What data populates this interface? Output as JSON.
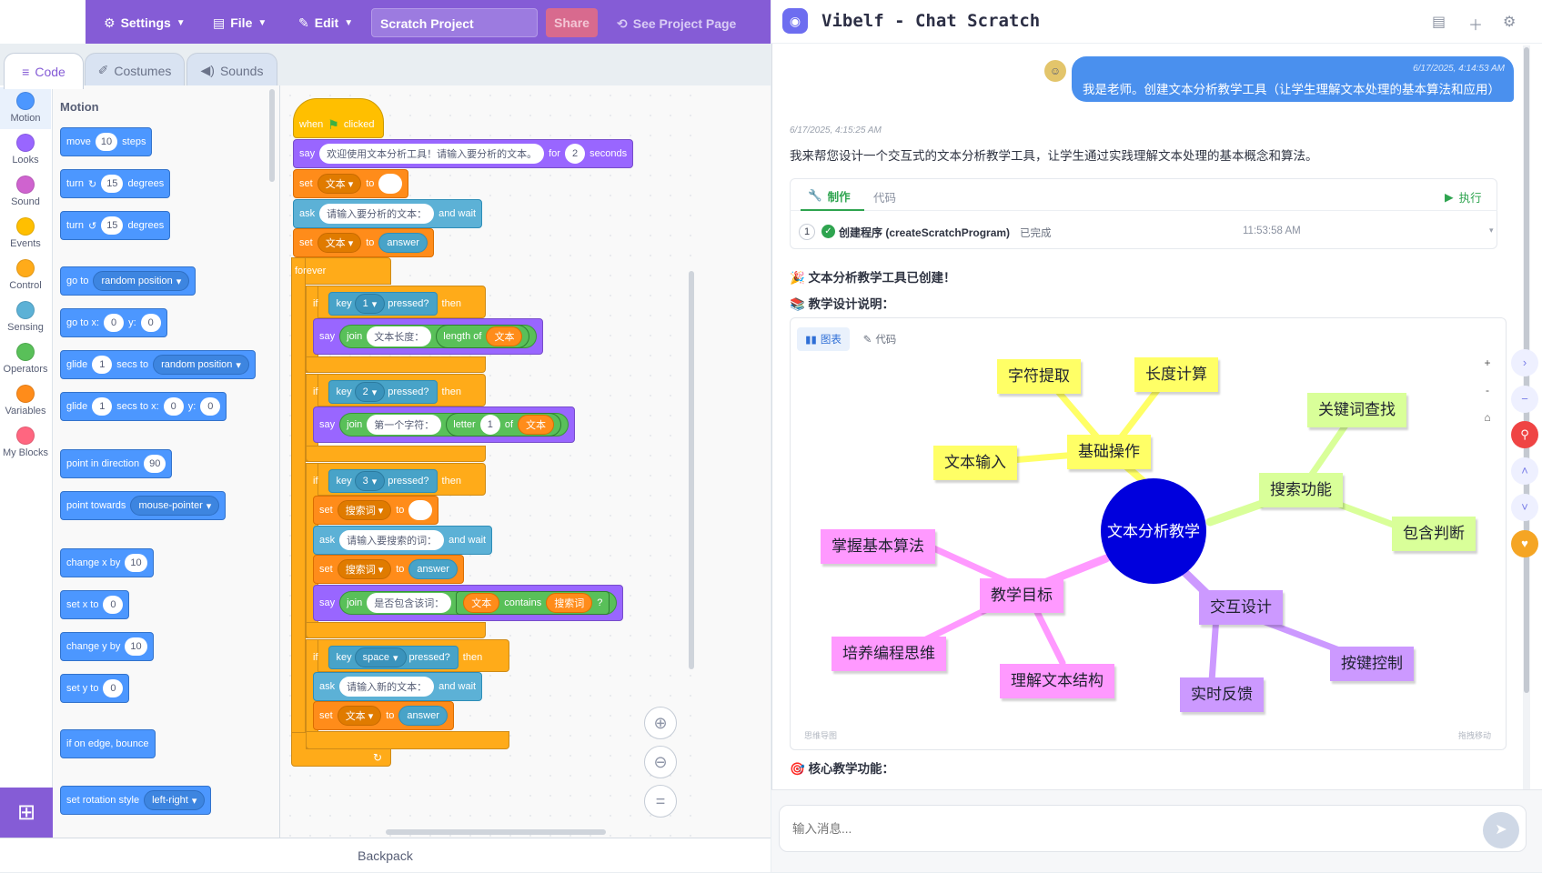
{
  "menubar": {
    "settings": "Settings",
    "file": "File",
    "edit": "Edit",
    "project_name": "Scratch Project",
    "share": "Share",
    "see_project": "See Project Page"
  },
  "tabs": {
    "code": "Code",
    "costumes": "Costumes",
    "sounds": "Sounds"
  },
  "categories": [
    {
      "label": "Motion",
      "color": "#4c97ff"
    },
    {
      "label": "Looks",
      "color": "#9966ff"
    },
    {
      "label": "Sound",
      "color": "#cf63cf"
    },
    {
      "label": "Events",
      "color": "#ffbf00"
    },
    {
      "label": "Control",
      "color": "#ffab19"
    },
    {
      "label": "Sensing",
      "color": "#5cb1d6"
    },
    {
      "label": "Operators",
      "color": "#59c059"
    },
    {
      "label": "Variables",
      "color": "#ff8c1a"
    },
    {
      "label": "My Blocks",
      "color": "#ff6680"
    }
  ],
  "palette": {
    "header": "Motion",
    "move": {
      "a": "move",
      "v": "10",
      "b": "steps"
    },
    "turn_r": {
      "a": "turn",
      "v": "15",
      "b": "degrees"
    },
    "turn_l": {
      "a": "turn",
      "v": "15",
      "b": "degrees"
    },
    "goto": {
      "a": "go to",
      "d": "random position"
    },
    "gotoxy": {
      "a": "go to x:",
      "x": "0",
      "y_l": "y:",
      "y": "0"
    },
    "glide": {
      "a": "glide",
      "v": "1",
      "b": "secs to",
      "d": "random position"
    },
    "glidexy": {
      "a": "glide",
      "v": "1",
      "b": "secs to x:",
      "x": "0",
      "y_l": "y:",
      "y": "0"
    },
    "point_dir": {
      "a": "point in direction",
      "v": "90"
    },
    "point_towards": {
      "a": "point towards",
      "d": "mouse-pointer"
    },
    "changex": {
      "a": "change x by",
      "v": "10"
    },
    "setx": {
      "a": "set x to",
      "v": "0"
    },
    "changey": {
      "a": "change y by",
      "v": "10"
    },
    "sety": {
      "a": "set y to",
      "v": "0"
    },
    "bounce": "if on edge, bounce",
    "rotation": {
      "a": "set rotation style",
      "d": "left-right"
    }
  },
  "script": {
    "when": "when",
    "clicked": "clicked",
    "say1": {
      "a": "say",
      "t": "欢迎使用文本分析工具！请输入要分析的文本。",
      "for": "for",
      "n": "2",
      "sec": "seconds"
    },
    "set1": {
      "a": "set",
      "var": "文本",
      "to": "to",
      "val": ""
    },
    "ask1": {
      "a": "ask",
      "t": "请输入要分析的文本：",
      "w": "and wait"
    },
    "set2": {
      "a": "set",
      "var": "文本",
      "to": "to",
      "ans": "answer"
    },
    "forever": "forever",
    "if1": {
      "if": "if",
      "key": "key",
      "k": "1",
      "pressed": "pressed?",
      "then": "then"
    },
    "say2": {
      "a": "say",
      "join": "join",
      "t": "文本长度：",
      "len": "length of",
      "var": "文本"
    },
    "if2": {
      "if": "if",
      "key": "key",
      "k": "2",
      "pressed": "pressed?",
      "then": "then"
    },
    "say3": {
      "a": "say",
      "join": "join",
      "t": "第一个字符：",
      "letter": "letter",
      "n": "1",
      "of": "of",
      "var": "文本"
    },
    "if3": {
      "if": "if",
      "key": "key",
      "k": "3",
      "pressed": "pressed?",
      "then": "then"
    },
    "set3": {
      "a": "set",
      "var": "搜索词",
      "to": "to",
      "val": ""
    },
    "ask2": {
      "a": "ask",
      "t": "请输入要搜索的词：",
      "w": "and wait"
    },
    "set4": {
      "a": "set",
      "var": "搜索词",
      "to": "to",
      "ans": "answer"
    },
    "say4": {
      "a": "say",
      "join": "join",
      "t": "是否包含该词：",
      "var": "文本",
      "contains": "contains",
      "var2": "搜索词",
      "q": "?"
    },
    "if4": {
      "if": "if",
      "key": "key",
      "k": "space",
      "pressed": "pressed?",
      "then": "then"
    },
    "ask3": {
      "a": "ask",
      "t": "请输入新的文本：",
      "w": "and wait"
    },
    "set5": {
      "a": "set",
      "var": "文本",
      "to": "to",
      "ans": "answer"
    }
  },
  "backpack": "Backpack",
  "chat": {
    "title": "Vibelf - Chat Scratch",
    "user_ts": "6/17/2025, 4:14:53 AM",
    "user_msg": "我是老师。创建文本分析教学工具（让学生理解文本处理的基本算法和应用）",
    "bot_ts": "6/17/2025, 4:15:25 AM",
    "bot_msg": "我来帮您设计一个交互式的文本分析教学工具，让学生通过实践理解文本处理的基本概念和算法。",
    "tool_tab_make": "制作",
    "tool_tab_code": "代码",
    "run": "执行",
    "step_num": "1",
    "step_label": "创建程序 (createScratchProgram)",
    "step_status": "已完成",
    "step_time": "11:53:58 AM",
    "msg_created": "🎉 文本分析教学工具已创建！",
    "msg_design": "📚 教学设计说明：",
    "map_tab_chart": "图表",
    "map_tab_code": "代码",
    "map_zoom_in": "+",
    "map_zoom_out": "-",
    "map_home": "⌂",
    "map_label_left": "思维导图",
    "map_label_right": "拖拽移动",
    "msg_core": "🎯 核心教学功能：",
    "input_placeholder": "输入消息..."
  },
  "mindmap": {
    "center": "文本分析教学",
    "nodes": {
      "basic": "基础操作",
      "extract": "字符提取",
      "length": "长度计算",
      "input": "文本输入",
      "search": "搜索功能",
      "keyword": "关键词查找",
      "contains": "包含判断",
      "goal": "教学目标",
      "algo": "掌握基本算法",
      "thinking": "培养编程思维",
      "structure": "理解文本结构",
      "interact": "交互设计",
      "keys": "按键控制",
      "feedback": "实时反馈"
    },
    "colors": {
      "center": "#0000dd",
      "basic": "#ffff66",
      "search": "#d9ff99",
      "goal": "#ff99ff",
      "interact": "#cc99ff"
    }
  }
}
